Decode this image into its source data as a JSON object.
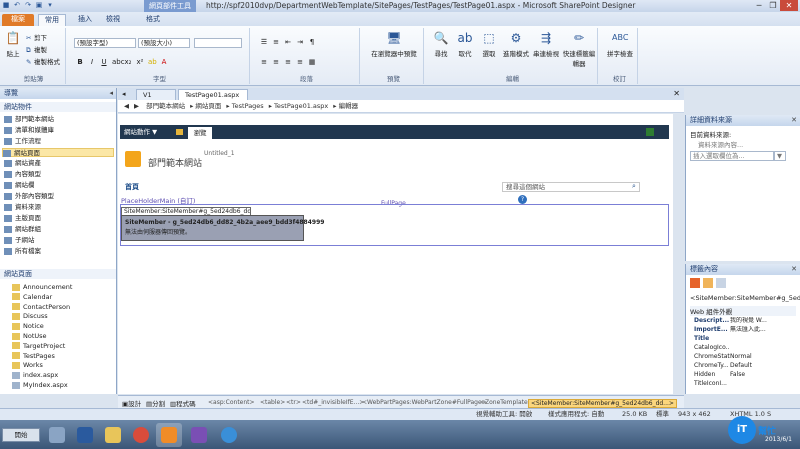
{
  "window": {
    "title": "http://spf2010dvp/DepartmentWebTemplate/SitePages/TestPages/TestPage01.aspx - Microsoft SharePoint Designer",
    "context_tab": "網頁部件工具",
    "controls": [
      "─",
      "❐",
      "✕"
    ]
  },
  "ribbon_tabs": {
    "file": "檔案",
    "home": "常用",
    "insert": "插入",
    "edit": "檢視",
    "format": "格式"
  },
  "ribbon": {
    "clipboard": {
      "paste": "貼上",
      "cut": "剪下",
      "copy": "複製",
      "format_painter": "複製格式",
      "label": "剪貼簿"
    },
    "font": {
      "font_name": "(預設字型)",
      "font_size": "(預設大小)",
      "label": "字型"
    },
    "paragraph": {
      "label": "段落"
    },
    "preview": {
      "preview_in_browser": "在瀏覽器中預覽",
      "label": "預覽"
    },
    "editing": {
      "find": "尋找",
      "replace": "取代",
      "select": "選取",
      "advanced": "進階模式",
      "skewer": "串連檢視",
      "quick_tag": "快速標籤編輯器",
      "label": "編輯"
    },
    "proofing": {
      "spelling": "拼字檢查",
      "label": "校訂"
    }
  },
  "nav": {
    "title": "導覽",
    "site_objects_header": "網站物件",
    "items": [
      {
        "label": "部門範本網站"
      },
      {
        "label": "清單和媒體庫"
      },
      {
        "label": "工作流程"
      },
      {
        "label": "網站頁面"
      },
      {
        "label": "網站資產"
      },
      {
        "label": "內容類型"
      },
      {
        "label": "網站欄"
      },
      {
        "label": "外部內容類型"
      },
      {
        "label": "資料來源"
      },
      {
        "label": "主版頁面"
      },
      {
        "label": "網站群組"
      },
      {
        "label": "子網站"
      },
      {
        "label": "所有檔案"
      }
    ],
    "site_pages_header": "網站頁面",
    "folders": [
      {
        "label": "Announcement"
      },
      {
        "label": "Calendar"
      },
      {
        "label": "ContactPerson"
      },
      {
        "label": "Discuss"
      },
      {
        "label": "Notice"
      },
      {
        "label": "NotUse"
      },
      {
        "label": "TargetProject"
      },
      {
        "label": "TestPages"
      },
      {
        "label": "Works"
      },
      {
        "label": "index.aspx"
      },
      {
        "label": "MyIndex.aspx"
      }
    ]
  },
  "doc_tabs": {
    "v1": "V1",
    "testpage": "TestPage01.aspx"
  },
  "breadcrumb": [
    "部門範本網站",
    "網站頁面",
    "TestPages",
    "TestPage01.aspx",
    "編輯器"
  ],
  "design": {
    "site_actions": "網站動作 ▼",
    "browse_tab": "瀏覽",
    "site_title": "部門範本網站",
    "untitled": "Untitled_1",
    "home_link": "首頁",
    "search_placeholder": "搜尋這個網站",
    "placeholder_label": "PlaceHolderMain (自訂)",
    "fullpage_label": "FullPage",
    "webpart_title": "SiteMember:SiteMember#g_5ed24db6_dd...",
    "webpart_line1": "SiteMember - g_5ed24db6_dd82_4b2a_aee9_bdd3f4884999",
    "webpart_line2": "無法由伺服器傳回預覽。"
  },
  "right_pane_1": {
    "title": "詳細資料來源",
    "current_source": "目前資料來源:",
    "none": "資料來源內容...",
    "insert_field": "插入選取欄位為...",
    "arrow": "▼"
  },
  "right_pane_2": {
    "title": "標籤內容",
    "tag_path": "<SiteMember:SiteMember#g_5ed...",
    "section": "Web 組件外觀",
    "props": [
      {
        "k": "Descript...",
        "v": "我的視覺 W...",
        "bold": true
      },
      {
        "k": "ImportE...",
        "v": "無法匯入此...",
        "bold": true
      },
      {
        "k": "Title",
        "v": "",
        "bold": true
      },
      {
        "k": "CatalogIco...",
        "v": "",
        "bold": false
      },
      {
        "k": "ChromeState",
        "v": "Normal",
        "bold": false
      },
      {
        "k": "ChromeTy...",
        "v": "Default",
        "bold": false
      },
      {
        "k": "Hidden",
        "v": "False",
        "bold": false
      },
      {
        "k": "TitleIconI...",
        "v": "",
        "bold": false
      }
    ]
  },
  "tagbar": {
    "design": "設計",
    "split": "分割",
    "code": "程式碼",
    "crumbs": [
      "<asp:Content>",
      "<table>",
      "<tr>",
      "<td#_invisibleIfE...>",
      "<WebPartPages:WebPartZone#FullPage>",
      "<ZoneTemplate>"
    ],
    "active": "<SiteMember:SiteMember#g_5ed24db6_dd...>"
  },
  "statusbar": {
    "visual_aids": "視覺輔助工具: 開啟",
    "style_app": "樣式應用程式: 自動",
    "size": "25.0 KB",
    "standard": "標準",
    "dims": "943 x 462",
    "xhtml": "XHTML 1.0 S"
  },
  "taskbar": {
    "start": "開始",
    "time": "2013/6/1"
  },
  "watermark": {
    "it": "iT",
    "help": "幫忙"
  }
}
